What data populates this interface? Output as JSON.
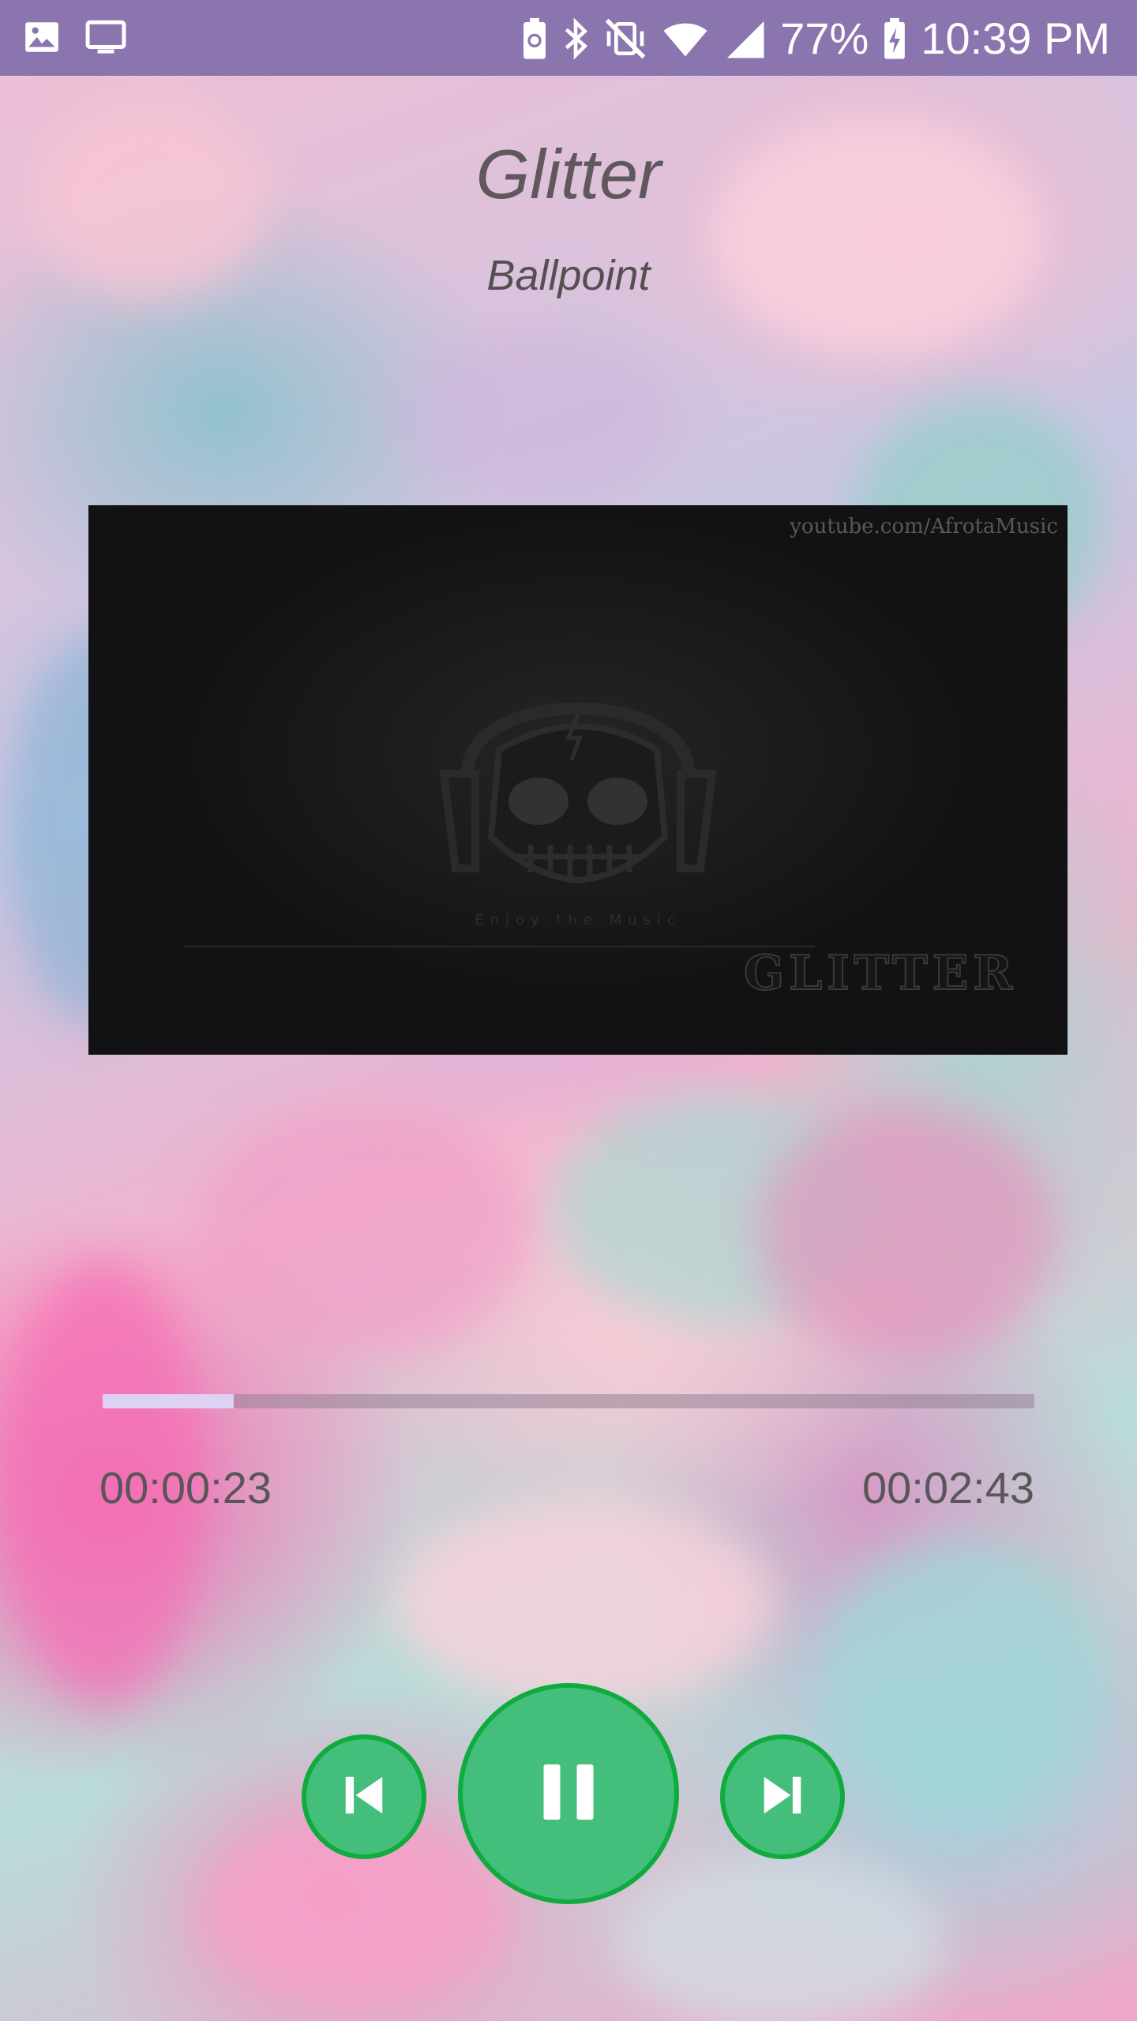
{
  "status_bar": {
    "battery": "77%",
    "time": "10:39 PM",
    "icons_left": [
      "gallery-icon",
      "cast-screen-icon"
    ],
    "icons_right": [
      "battery-saver-icon",
      "bluetooth-icon",
      "vibrate-icon",
      "wifi-icon",
      "cell-signal-icon",
      "battery-charging-icon"
    ]
  },
  "song": {
    "title": "Glitter",
    "artist": "Ballpoint"
  },
  "album_art": {
    "watermark": "youtube.com/AfrotaMusic",
    "tagline": "Enjoy the Music",
    "logo_text": "GLITTER"
  },
  "playback": {
    "current_time": "00:00:23",
    "total_time": "00:02:43",
    "progress_fraction": 0.141
  },
  "controls": {
    "prev": "skip-previous-icon",
    "play_pause": "pause-icon",
    "next": "skip-next-icon"
  },
  "colors": {
    "status_bar": "#8a75ae",
    "control_fill": "#44be7b",
    "control_border": "#10ab3e",
    "progress_fill": "#ddd1f4"
  }
}
